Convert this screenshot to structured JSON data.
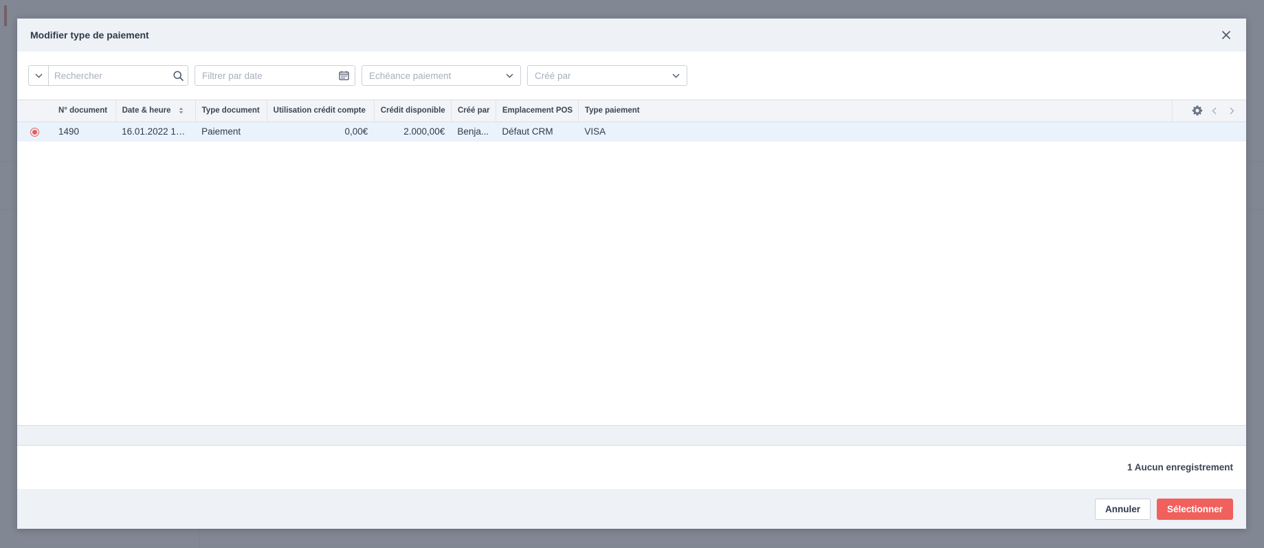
{
  "modal": {
    "title": "Modifier type de paiement"
  },
  "filters": {
    "search_placeholder": "Rechercher",
    "date_placeholder": "Filtrer par date",
    "echeance_placeholder": "Echéance paiement",
    "cree_par_placeholder": "Créé par"
  },
  "table": {
    "columns": [
      "N° document",
      "Date & heure",
      "Type document",
      "Utilisation crédit compte",
      "Crédit disponible",
      "Créé par",
      "Emplacement POS",
      "Type paiement"
    ],
    "rows": [
      {
        "selected": true,
        "numero": "1490",
        "date": "16.01.2022 14:...",
        "type_document": "Paiement",
        "utilisation_credit": "0,00€",
        "credit_disponible": "2.000,00€",
        "cree_par": "Benja...",
        "emplacement_pos": "Défaut CRM",
        "type_paiement": "VISA"
      }
    ]
  },
  "footer": {
    "record_count": "1 Aucun enregistrement",
    "cancel_label": "Annuler",
    "select_label": "Sélectionner"
  },
  "colors": {
    "accent": "#f0605d",
    "selected_row": "#eaf3fc",
    "header_bg": "#eef1f5"
  }
}
